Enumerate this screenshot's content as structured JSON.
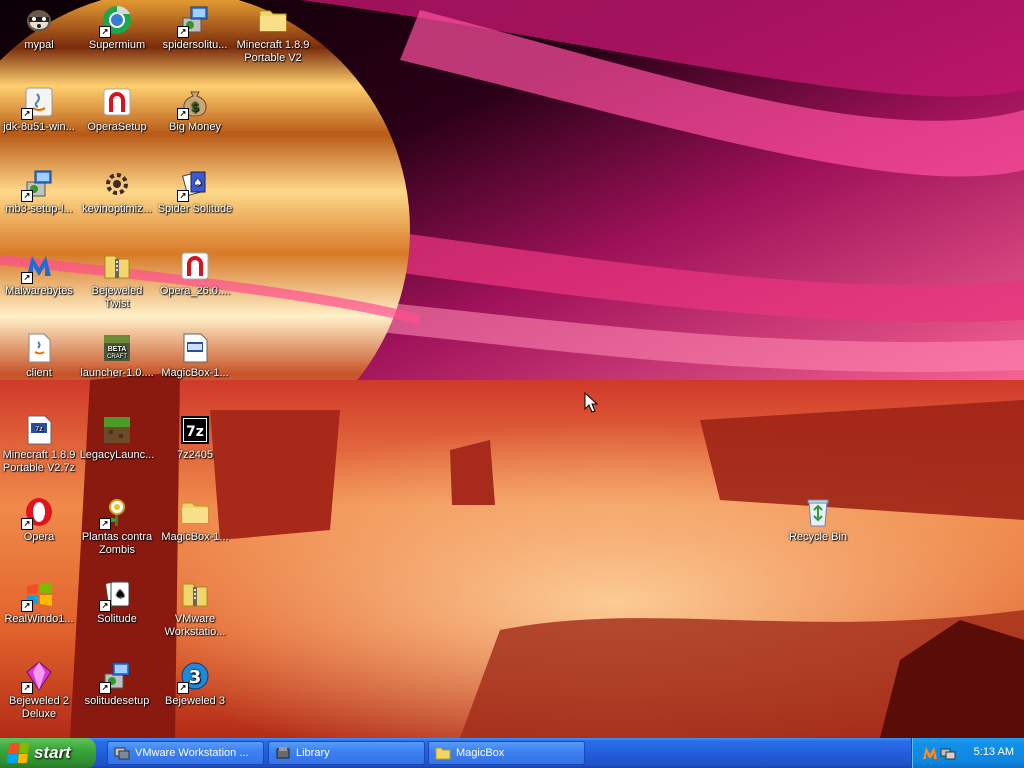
{
  "desktop": {
    "icons": [
      {
        "label": "mypal",
        "icon": "raccoon-icon"
      },
      {
        "label": "Supermium",
        "icon": "supermium-icon"
      },
      {
        "label": "spidersolitu...",
        "icon": "installer-icon"
      },
      {
        "label": "Minecraft 1.8.9\nPortable V2",
        "icon": "folder-icon"
      },
      {
        "label": "jdk-8u51-win...",
        "icon": "java-icon"
      },
      {
        "label": "OperaSetup",
        "icon": "opera-setup-icon"
      },
      {
        "label": "Big Money",
        "icon": "money-bag-icon"
      },
      {
        "label": "mb3-setup-l...",
        "icon": "installer-icon"
      },
      {
        "label": "kevinoptimiz...",
        "icon": "gear-icon"
      },
      {
        "label": "Spider Solitude",
        "icon": "cards-icon"
      },
      {
        "label": "Malwarebytes",
        "icon": "malwarebytes-icon"
      },
      {
        "label": "Bejeweled\nTwist",
        "icon": "zip-icon"
      },
      {
        "label": "Opera_26.0....",
        "icon": "opera-installer-icon"
      },
      {
        "label": "client",
        "icon": "java-file-icon"
      },
      {
        "label": "launcher-1.0....",
        "icon": "minecraft-beta-icon"
      },
      {
        "label": "MagicBox-1...",
        "icon": "exe-file-icon"
      },
      {
        "label": "Minecraft 1.8.9\nPortable V2.7z",
        "icon": "archive-file-icon"
      },
      {
        "label": "LegacyLaunc...",
        "icon": "minecraft-block-icon"
      },
      {
        "label": "7z2405",
        "icon": "7zip-icon"
      },
      {
        "label": "Opera",
        "icon": "opera-icon"
      },
      {
        "label": "Plantas contra\nZombis",
        "icon": "plant-icon"
      },
      {
        "label": "MagicBox-1...",
        "icon": "folder-icon"
      },
      {
        "label": "RealWindo1...",
        "icon": "windows-icon"
      },
      {
        "label": "Solitude",
        "icon": "cards-icon"
      },
      {
        "label": "VMware\nWorkstatio...",
        "icon": "zip-icon"
      },
      {
        "label": "Bejeweled 2\nDeluxe",
        "icon": "gem-icon"
      },
      {
        "label": "solitudesetup",
        "icon": "installer-icon"
      },
      {
        "label": "Bejeweled 3",
        "icon": "gem-3-icon"
      },
      {
        "label": "Recycle Bin",
        "icon": "recycle-bin-icon"
      }
    ]
  },
  "taskbar": {
    "start_label": "start",
    "tasks": [
      {
        "label": "VMware Workstation ...",
        "icon": "vmware-icon"
      },
      {
        "label": "Library",
        "icon": "library-icon"
      },
      {
        "label": "MagicBox",
        "icon": "folder-icon"
      }
    ],
    "clock": "5:13 AM"
  },
  "colors": {
    "taskbar": "#245edb",
    "start": "#3aa53a",
    "tray": "#0f85df"
  }
}
